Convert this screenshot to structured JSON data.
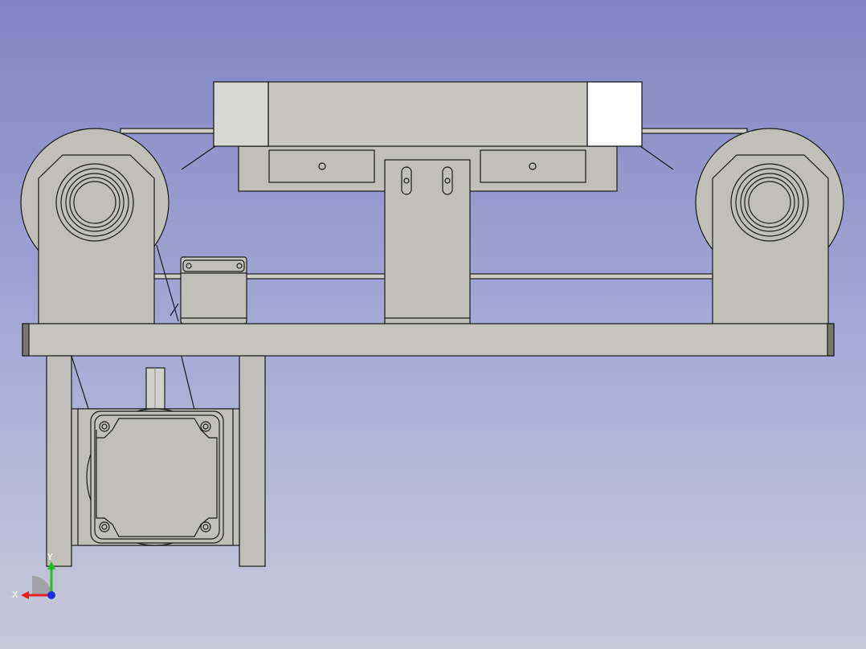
{
  "view": {
    "background_top": "#7f83c3",
    "background_bottom": "#c7c9d9",
    "part_fill": "#c0c0b8",
    "edge_color": "#1a1a1a",
    "highlight_fill": "#ffffff"
  },
  "axis": {
    "x_label": "X",
    "y_label": "Y",
    "x_color": "#e02020",
    "y_color": "#20c020",
    "z_color": "#2030e0"
  }
}
